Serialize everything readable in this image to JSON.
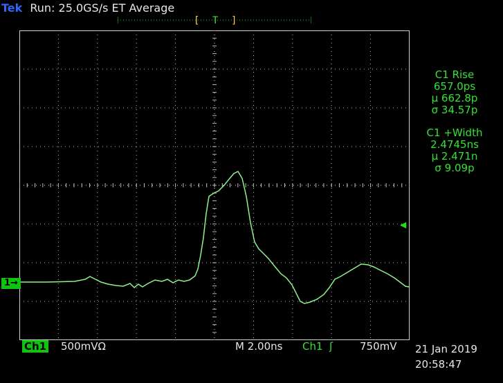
{
  "header": {
    "brand": "Tek",
    "status": "Run: 25.0GS/s ET Average"
  },
  "trigger_position": {
    "left": "[",
    "mark": "T",
    "right": "]"
  },
  "measurements": {
    "rise": {
      "title": "C1 Rise",
      "value": "657.0ps",
      "mean": "µ 662.8p",
      "sigma": "σ 34.57p"
    },
    "width": {
      "title": "C1 +Width",
      "value": "2.4745ns",
      "mean": "µ 2.471n",
      "sigma": "σ 9.09p"
    }
  },
  "channel_marker": "1→",
  "footer": {
    "channel_label": "Ch1",
    "channel_scale": "500mVΩ",
    "timebase": "M 2.00ns",
    "trigger_channel": "Ch1",
    "trigger_slope": "ʃ",
    "trigger_level": "750mV",
    "date": "21 Jan 2019",
    "time": "20:58:47"
  },
  "colors": {
    "trace": "#8ff28f",
    "grid": "#d0d0d0",
    "accent": "#33e333",
    "brand": "#2f66ff"
  }
}
